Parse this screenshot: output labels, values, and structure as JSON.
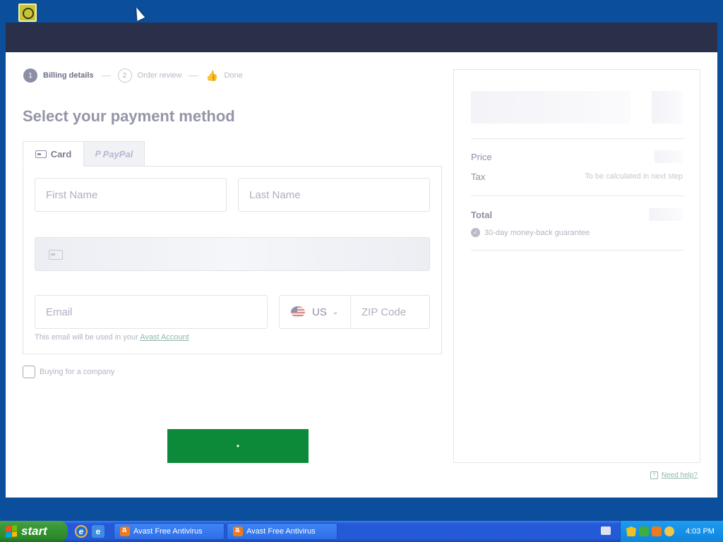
{
  "steps": [
    {
      "num": "1",
      "label": "Billing details"
    },
    {
      "num": "2",
      "label": "Order review"
    },
    {
      "label": "Done"
    }
  ],
  "main": {
    "title": "Select your payment method",
    "tabs": {
      "card": "Card",
      "paypal": "PayPal"
    },
    "fields": {
      "first_name": "First Name",
      "last_name": "Last Name",
      "email": "Email",
      "country": "US",
      "zip": "ZIP Code"
    },
    "email_note": "This email will be used in your",
    "email_note_link": "Avast Account",
    "company_label": "Buying for a company",
    "submit_label": "•"
  },
  "summary": {
    "price_label": "Price",
    "tax_label": "Tax",
    "tax_note": "To be calculated in next step",
    "total_label": "Total",
    "guarantee": "30-day money-back guarantee"
  },
  "help": {
    "label": "Need help?"
  },
  "taskbar": {
    "start_label": "start",
    "tasks": [
      "Avast Free Antivirus",
      "Avast Free Antivirus"
    ],
    "clock": "4:03 PM"
  },
  "colors": {
    "header": "#2a2f4a",
    "submit": "#0c8a3a",
    "link": "#8fb8a8",
    "desktop": "#0a4e9c"
  },
  "icons": [
    "scheduled-task-icon",
    "card-icon",
    "paypal-icon",
    "thumbs-up-icon",
    "flag-us-icon",
    "chevron-down-icon",
    "shield-check-icon",
    "help-icon",
    "windows-logo-icon",
    "ie-icon",
    "avast-icon",
    "keyboard-icon"
  ]
}
